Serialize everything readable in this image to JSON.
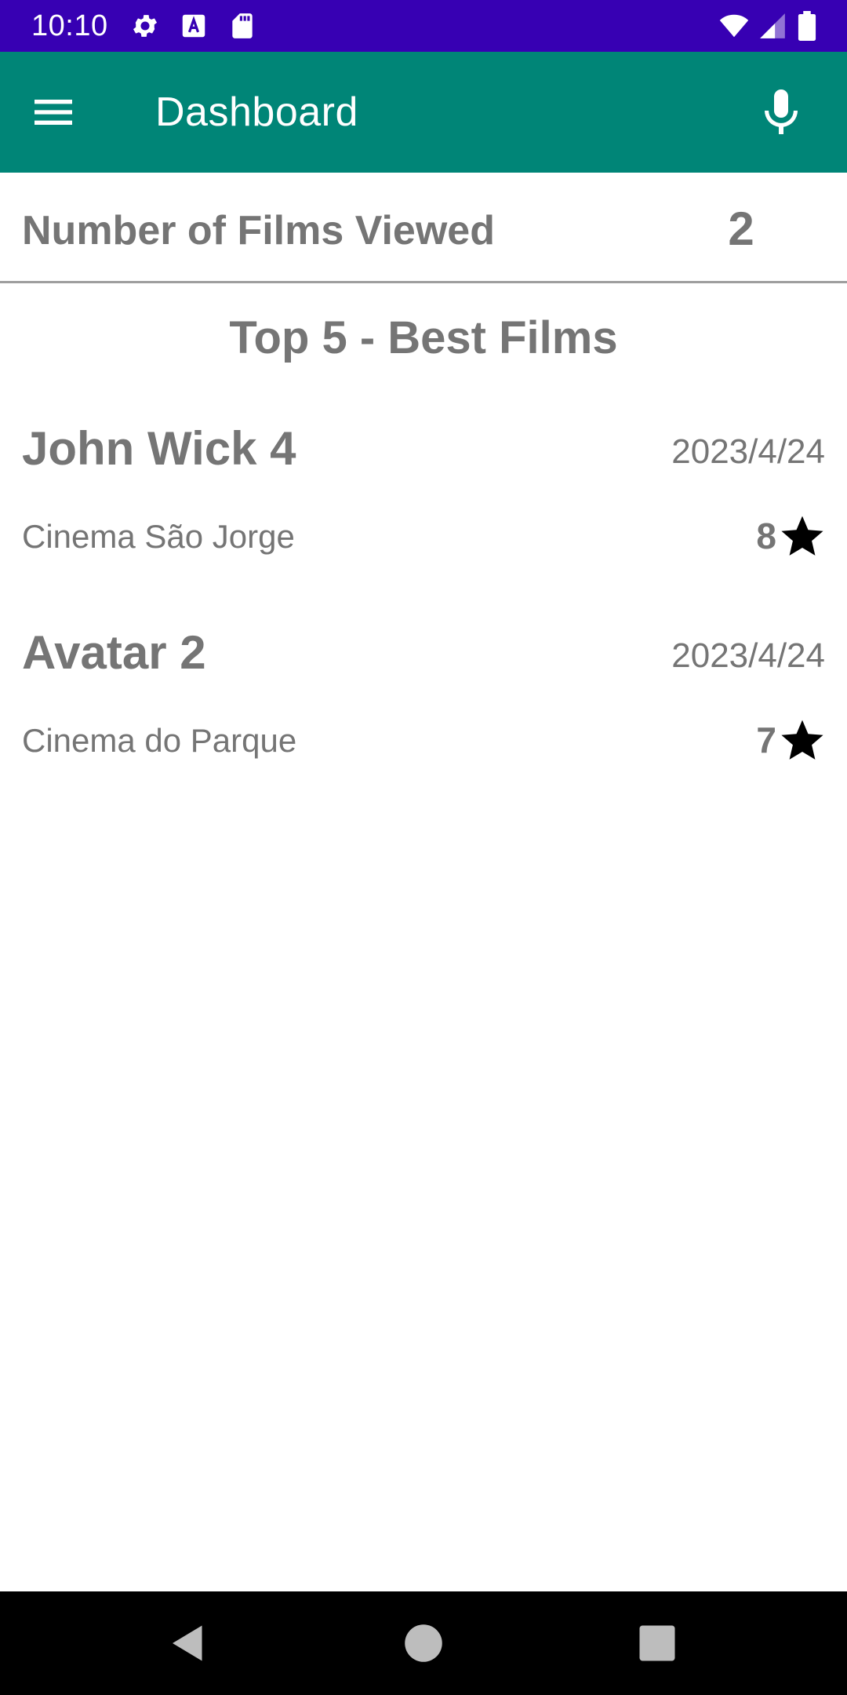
{
  "status_bar": {
    "time": "10:10",
    "left_icons": [
      "gear-icon",
      "text-a-icon",
      "sd-card-icon"
    ],
    "right_icons": [
      "wifi-icon",
      "cell-signal-icon",
      "battery-icon"
    ],
    "background": "#3700b3"
  },
  "app_bar": {
    "title": "Dashboard",
    "menu_icon": "menu-icon",
    "mic_icon": "microphone-icon",
    "background": "#008577"
  },
  "films_viewed": {
    "label": "Number of Films Viewed",
    "count": "2"
  },
  "top_section": {
    "title": "Top 5 - Best Films"
  },
  "films": [
    {
      "title": "John Wick 4",
      "date": "2023/4/24",
      "cinema": "Cinema São Jorge",
      "rating": "8",
      "rating_icon": "star-icon"
    },
    {
      "title": "Avatar 2",
      "date": "2023/4/24",
      "cinema": "Cinema do Parque",
      "rating": "7",
      "rating_icon": "star-icon"
    }
  ],
  "nav_bar": {
    "buttons": [
      "back-icon",
      "home-icon",
      "recents-icon"
    ]
  }
}
